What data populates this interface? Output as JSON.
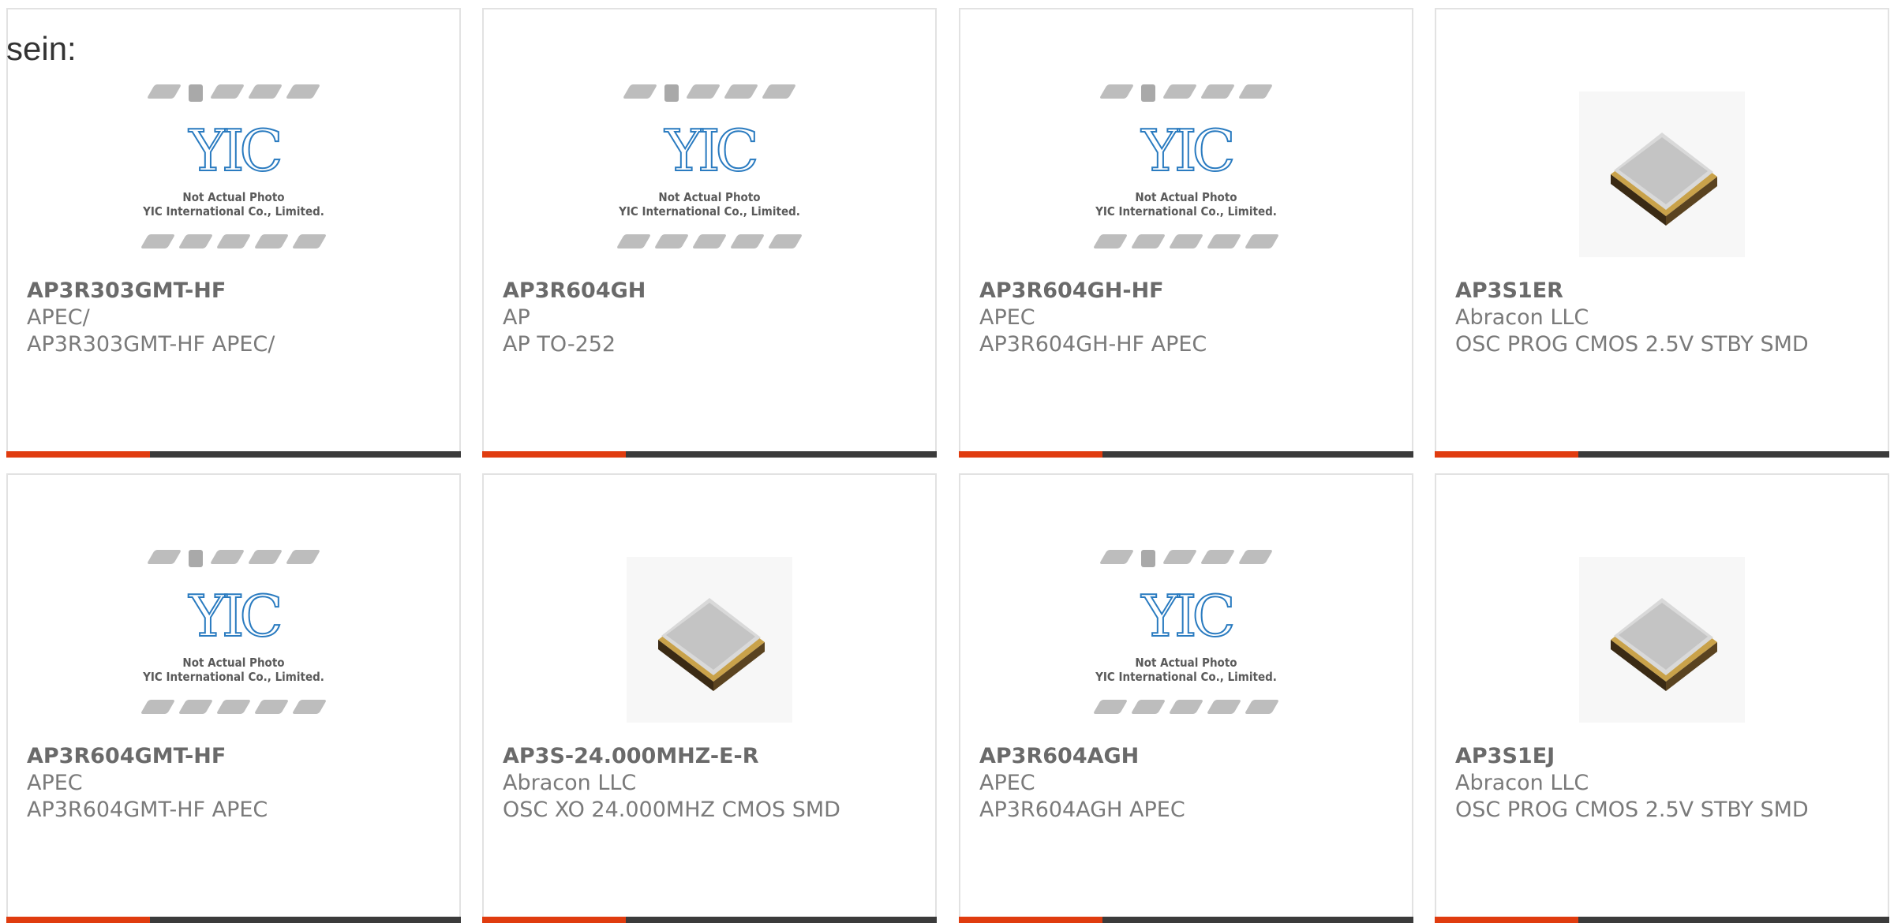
{
  "header": {
    "lead_text": "sein:"
  },
  "placeholder": {
    "logo_text": "YIC",
    "caption_line1": "Not Actual Photo",
    "caption_line2": "YIC International Co., Limited."
  },
  "colors": {
    "accent": "#e03c0f",
    "bar": "#3b3b3b",
    "border": "#e2e2e2",
    "logo_blue": "#2a7bc0"
  },
  "products": [
    {
      "part": "AP3R303GMT-HF",
      "manufacturer": "APEC/",
      "description": "AP3R303GMT-HF APEC/",
      "image": "yic-placeholder-icon"
    },
    {
      "part": "AP3R604GH",
      "manufacturer": "AP",
      "description": "AP TO-252",
      "image": "yic-placeholder-icon"
    },
    {
      "part": "AP3R604GH-HF",
      "manufacturer": "APEC",
      "description": "AP3R604GH-HF APEC",
      "image": "yic-placeholder-icon"
    },
    {
      "part": "AP3S1ER",
      "manufacturer": "Abracon LLC",
      "description": "OSC PROG CMOS 2.5V STBY SMD",
      "image": "crystal-oscillator-icon"
    },
    {
      "part": "AP3R604GMT-HF",
      "manufacturer": "APEC",
      "description": "AP3R604GMT-HF APEC",
      "image": "yic-placeholder-icon"
    },
    {
      "part": "AP3S-24.000MHZ-E-R",
      "manufacturer": "Abracon LLC",
      "description": "OSC XO 24.000MHZ CMOS SMD",
      "image": "crystal-oscillator-icon"
    },
    {
      "part": "AP3R604AGH",
      "manufacturer": "APEC",
      "description": "AP3R604AGH APEC",
      "image": "yic-placeholder-icon"
    },
    {
      "part": "AP3S1EJ",
      "manufacturer": "Abracon LLC",
      "description": "OSC PROG CMOS 2.5V STBY SMD",
      "image": "crystal-oscillator-icon"
    }
  ]
}
